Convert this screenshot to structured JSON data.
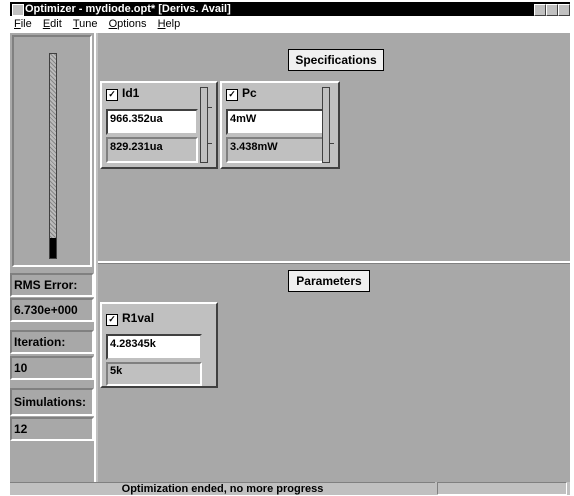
{
  "window": {
    "title": "Optimizer - mydiode.opt*  [Derivs. Avail]",
    "controls": [
      "minimize-icon",
      "maximize-icon",
      "close-icon"
    ]
  },
  "menu": {
    "items": [
      {
        "label": "File",
        "hotkey": "F",
        "rest": "ile"
      },
      {
        "label": "Edit",
        "hotkey": "E",
        "rest": "dit"
      },
      {
        "label": "Tune",
        "hotkey": "T",
        "rest": "une"
      },
      {
        "label": "Options",
        "hotkey": "O",
        "rest": "ptions"
      },
      {
        "label": "Help",
        "hotkey": "H",
        "rest": "elp"
      }
    ]
  },
  "left_panel": {
    "progress_level": 0.1,
    "rms_error_label": "RMS Error:",
    "rms_error_value": "6.730e+000",
    "iteration_label": "Iteration:",
    "iteration_value": "10",
    "simulations_label": "Simulations:",
    "simulations_value": "12"
  },
  "specifications": {
    "title": "Specifications",
    "items": [
      {
        "name": "Id1",
        "checked": true,
        "target": "966.352ua",
        "current": "829.231ua",
        "slider_level": 0.0
      },
      {
        "name": "Pc",
        "checked": true,
        "target": "4mW",
        "current": "3.438mW",
        "slider_level": 0.0
      }
    ]
  },
  "parameters": {
    "title": "Parameters",
    "items": [
      {
        "name": "R1val",
        "checked": true,
        "value": "4.28345k",
        "initial": "5k"
      }
    ]
  },
  "status": {
    "message": "Optimization ended, no more progress"
  },
  "colors": {
    "title_bar": "#000000",
    "panel_gray": "#c0c0c0",
    "left_panel_gray": "#a8a8a8"
  }
}
